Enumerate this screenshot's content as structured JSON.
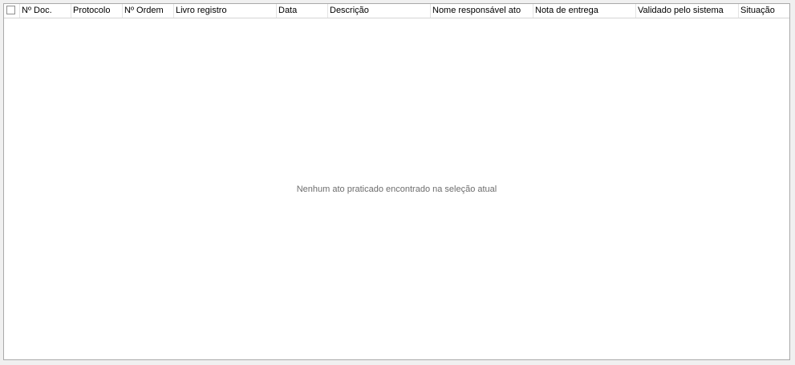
{
  "grid": {
    "columns": [
      {
        "label": ""
      },
      {
        "label": "Nº Doc."
      },
      {
        "label": "Protocolo"
      },
      {
        "label": "Nº Ordem"
      },
      {
        "label": "Livro registro"
      },
      {
        "label": "Data"
      },
      {
        "label": "Descrição"
      },
      {
        "label": "Nome responsável ato"
      },
      {
        "label": "Nota de entrega"
      },
      {
        "label": "Validado pelo sistema"
      },
      {
        "label": "Situação"
      }
    ],
    "empty_message": "Nenhum ato praticado encontrado na seleção atual"
  }
}
